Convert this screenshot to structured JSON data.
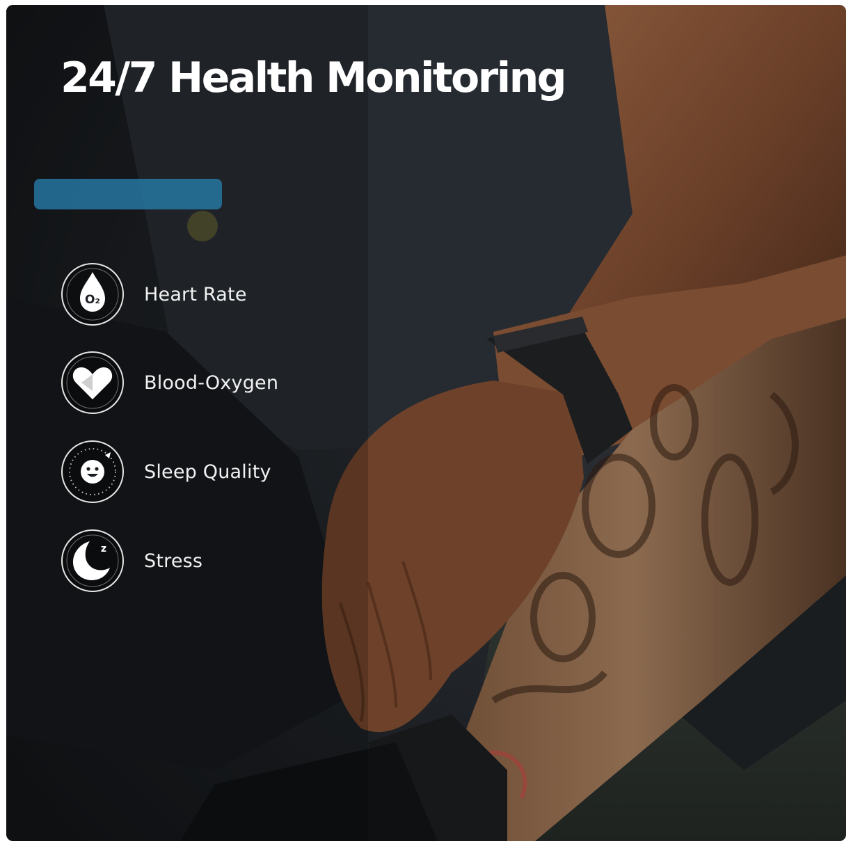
{
  "title": "24/7 Health Monitoring",
  "features": [
    {
      "label": "Heart Rate",
      "icon": "o2-drop-icon",
      "icon_text": "O₂"
    },
    {
      "label": "Blood-Oxygen",
      "icon": "heart-icon"
    },
    {
      "label": "Sleep Quality",
      "icon": "smiley-dial-icon"
    },
    {
      "label": "Stress",
      "icon": "crescent-moon-zzz-icon",
      "icon_text": "z"
    }
  ],
  "colors": {
    "background": "#1b1e22",
    "text": "#ffffff",
    "icon_ring": "#e6e6e6",
    "icon_fill": "#ffffff",
    "accent_blue": "#2f8fc4"
  }
}
